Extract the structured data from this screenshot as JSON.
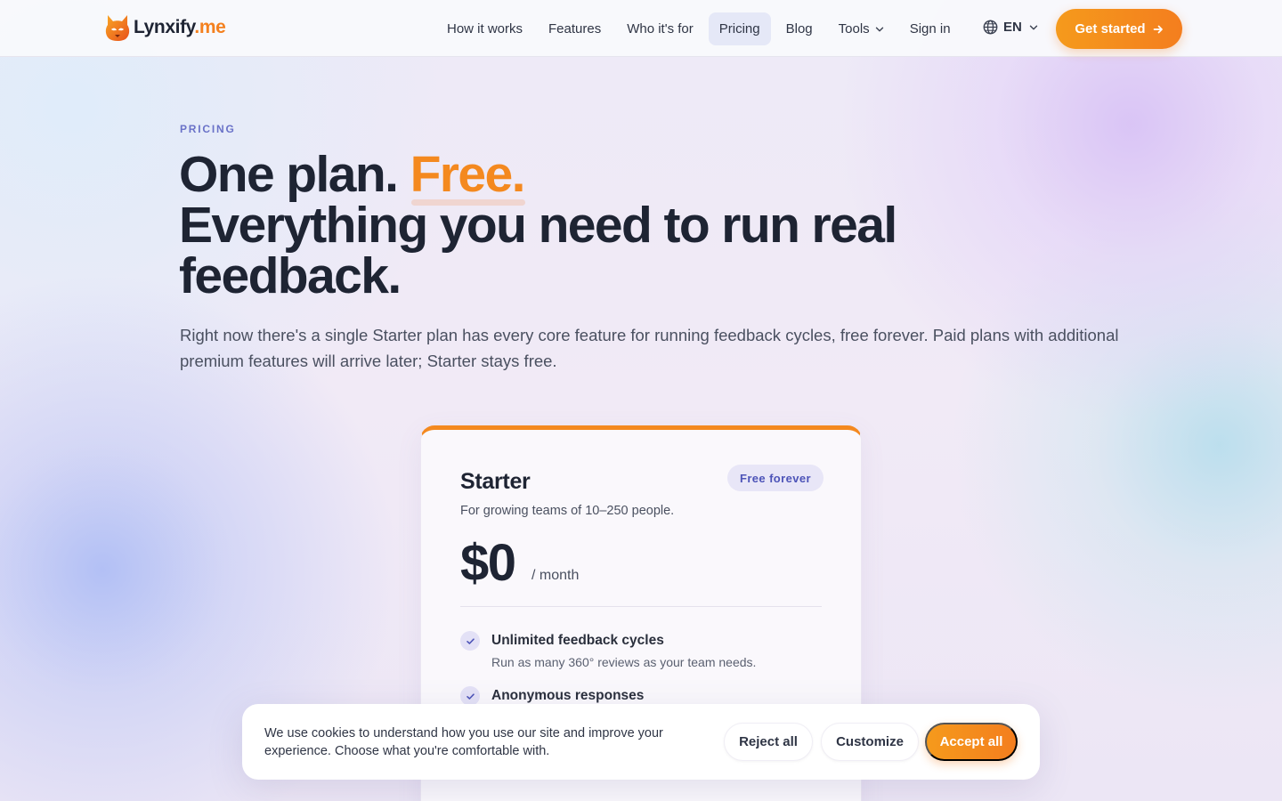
{
  "brand": {
    "name": "Lynxify",
    "tld": ".me",
    "colors": {
      "accent": "#f4811f",
      "ink": "#1e2433",
      "indigo": "#4d54b8"
    }
  },
  "nav": {
    "items": [
      {
        "label": "How it works"
      },
      {
        "label": "Features"
      },
      {
        "label": "Who it's for"
      },
      {
        "label": "Pricing",
        "active": true
      },
      {
        "label": "Blog"
      },
      {
        "label": "Tools",
        "has_dropdown": true
      },
      {
        "label": "Sign in"
      }
    ],
    "language": "EN",
    "cta": "Get started"
  },
  "hero": {
    "eyebrow": "PRICING",
    "title_prefix": "One plan.",
    "title_highlight": "Free.",
    "title_rest": "Everything you need to run real feedback.",
    "subtitle": "Right now there's a single Starter plan has every core feature for running feedback cycles, free forever. Paid plans with additional premium features will arrive later; Starter stays free."
  },
  "plan": {
    "name": "Starter",
    "badge": "Free forever",
    "description": "For growing teams of 10–250 people.",
    "price": "$0",
    "period": "/ month",
    "features": [
      {
        "title": "Unlimited feedback cycles",
        "description": "Run as many 360° reviews as your team needs."
      },
      {
        "title": "Anonymous responses",
        "description": ""
      }
    ]
  },
  "cookie_banner": {
    "text": "We use cookies to understand how you use our site and improve your experience. Choose what you're comfortable with.",
    "reject_label": "Reject all",
    "customize_label": "Customize",
    "accept_label": "Accept all"
  }
}
